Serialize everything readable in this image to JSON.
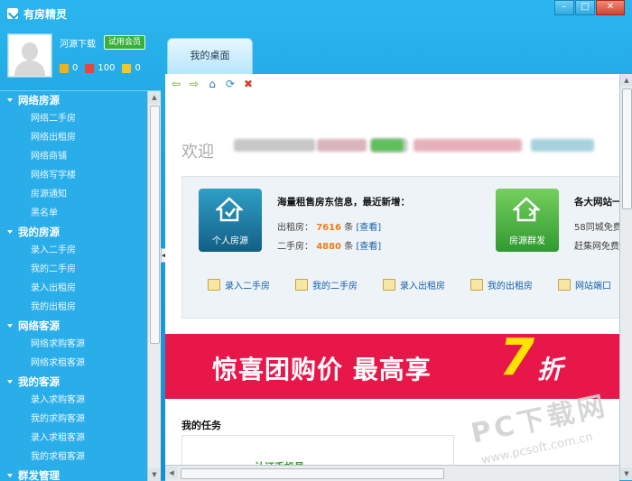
{
  "window": {
    "title": "有房精灵",
    "controls": [
      "minimize",
      "maximize",
      "close"
    ]
  },
  "user": {
    "name": "河源下载",
    "trial_label": "试用会员",
    "stats": [
      {
        "icon": "house-icon",
        "value": "0",
        "color": "#f0b21b"
      },
      {
        "icon": "points-icon",
        "value": "100",
        "color": "#e2483d"
      },
      {
        "icon": "mail-icon",
        "value": "0",
        "color": "#f2c62d"
      }
    ]
  },
  "sidebar": {
    "groups": [
      {
        "label": "网络房源",
        "items": [
          "网络二手房",
          "网络出租房",
          "网络商铺",
          "网络写字楼",
          "房源通知",
          "黑名单"
        ]
      },
      {
        "label": "我的房源",
        "items": [
          "录入二手房",
          "我的二手房",
          "录入出租房",
          "我的出租房"
        ]
      },
      {
        "label": "网络客源",
        "items": [
          "网络求购客源",
          "网络求租客源"
        ]
      },
      {
        "label": "我的客源",
        "items": [
          "录入求购客源",
          "我的求购客源",
          "录入求租客源",
          "我的求租客源"
        ]
      },
      {
        "label": "群发管理",
        "items": []
      }
    ]
  },
  "tab": {
    "label": "我的桌面"
  },
  "toolbar": {
    "icons": [
      "back-arrow-icon",
      "forward-arrow-icon",
      "home-icon",
      "refresh-icon",
      "stop-icon"
    ]
  },
  "welcome": {
    "text": "欢迎"
  },
  "info": {
    "card1_label": "个人房源",
    "card2_label": "房源群发",
    "title": "海量租售房东信息，最近新增：",
    "rent_label": "出租房：",
    "rent_count": "7616",
    "rent_unit": "条",
    "sale_label": "二手房：",
    "sale_count": "4880",
    "sale_unit": "条",
    "view_label": "[查看]",
    "title2": "各大网站一",
    "line2_1": "58同城免费",
    "line2_2": "赶集网免费",
    "colors": {
      "card1": "#1a7fa6",
      "card2": "#4cb84a",
      "count": "#f07d17"
    }
  },
  "quicklinks": [
    "录入二手房",
    "我的二手房",
    "录入出租房",
    "我的出租房",
    "网站端口"
  ],
  "banner": {
    "text": "惊喜团购价 最高享",
    "number": "7",
    "suffix": "折",
    "bg": "#e8174a",
    "number_color": "#fde400"
  },
  "tasks": {
    "title": "我的任务",
    "item": "认证手机号"
  },
  "watermark": {
    "main": "PC下载网",
    "sub": "www.pcsoft.com.cn"
  }
}
